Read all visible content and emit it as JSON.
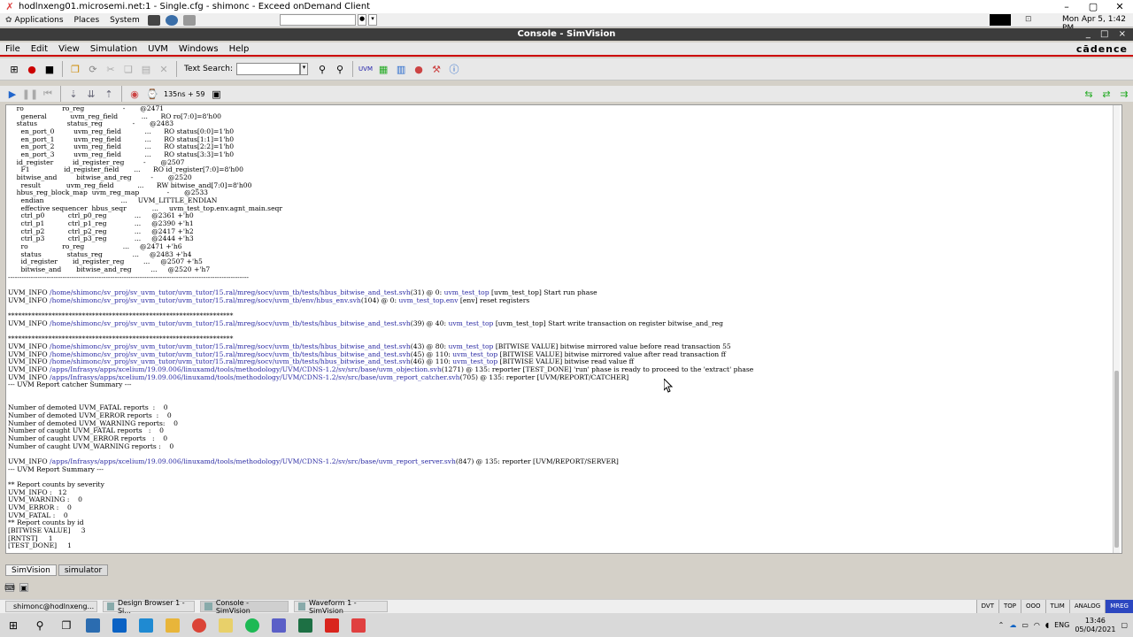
{
  "exceed": {
    "title": "hodlnxeng01.microsemi.net:1 - Single.cfg - shimonc - Exceed onDemand Client",
    "controls": [
      "–",
      "▢",
      "✕"
    ]
  },
  "gnome_panel": {
    "menus": [
      "Applications",
      "Places",
      "System"
    ],
    "clock": "Mon Apr 5,  1:42 PM"
  },
  "console_window": {
    "title": "Console - SimVision",
    "controls": "_ □ ×"
  },
  "menubar": {
    "items": [
      "File",
      "Edit",
      "View",
      "Simulation",
      "UVM",
      "Windows",
      "Help"
    ],
    "brand": "cādence"
  },
  "toolbar": {
    "text_search_label": "Text Search:",
    "sim_time": "135ns + 59"
  },
  "console_lines": [
    {
      "t": "    ro                  ro_reg                  -       @2471"
    },
    {
      "t": "      general           uvm_reg_field           ...      RO ro[7:0]=8'h00"
    },
    {
      "t": "    status              status_reg              -       @2483"
    },
    {
      "t": "      en_port_0         uvm_reg_field           ...      RO status[0:0]=1'h0"
    },
    {
      "t": "      en_port_1         uvm_reg_field           ...      RO status[1:1]=1'h0"
    },
    {
      "t": "      en_port_2         uvm_reg_field           ...      RO status[2:2]=1'h0"
    },
    {
      "t": "      en_port_3         uvm_reg_field           ...      RO status[3:3]=1'h0"
    },
    {
      "t": "    id_register         id_register_reg         -       @2507"
    },
    {
      "t": "      F1                id_register_field       ...      RO id_register[7:0]=8'h00"
    },
    {
      "t": "    bitwise_and         bitwise_and_reg         -       @2520"
    },
    {
      "t": "      result            uvm_reg_field           ...      RW bitwise_and[7:0]=8'h00"
    },
    {
      "t": "    hbus_reg_block_map  uvm_reg_map             -       @2533"
    },
    {
      "t": "      endian                                    ...     UVM_LITTLE_ENDIAN"
    },
    {
      "t": "      effective sequencer  hbus_seqr            ...     uvm_test_top.env.agnt_main.seqr"
    },
    {
      "t": "      ctrl_p0           ctrl_p0_reg             ...     @2361 +'h0"
    },
    {
      "t": "      ctrl_p1           ctrl_p1_reg             ...     @2390 +'h1"
    },
    {
      "t": "      ctrl_p2           ctrl_p2_reg             ...     @2417 +'h2"
    },
    {
      "t": "      ctrl_p3           ctrl_p3_reg             ...     @2444 +'h3"
    },
    {
      "t": "      ro                ro_reg                  ...     @2471 +'h6"
    },
    {
      "t": "      status            status_reg              ...     @2483 +'h4"
    },
    {
      "t": "      id_register       id_register_reg         ...     @2507 +'h5"
    },
    {
      "t": "      bitwise_and       bitwise_and_reg         ...     @2520 +'h7"
    },
    {
      "t": "----------------------------------------------------------------------------------------------------------"
    },
    {
      "t": ""
    },
    {
      "t": "UVM_INFO ",
      "p": "/home/shimonc/sv_proj/sv_uvm_tutor/uvm_tutor/15.ral/mreg/socv/uvm_tb/tests/hbus_bitwise_and_test.svh",
      "r": "(31) @ 0: ",
      "p2": "uvm_test_top",
      "r2": " [uvm_test_top] Start run phase"
    },
    {
      "t": "UVM_INFO ",
      "p": "/home/shimonc/sv_proj/sv_uvm_tutor/uvm_tutor/15.ral/mreg/socv/uvm_tb/env/hbus_env.svh",
      "r": "(104) @ 0: ",
      "p2": "uvm_test_top.env",
      "r2": " [env] reset registers"
    },
    {
      "t": ""
    },
    {
      "t": "*******************************************************************"
    },
    {
      "t": "UVM_INFO ",
      "p": "/home/shimonc/sv_proj/sv_uvm_tutor/uvm_tutor/15.ral/mreg/socv/uvm_tb/tests/hbus_bitwise_and_test.svh",
      "r": "(39) @ 40: ",
      "p2": "uvm_test_top",
      "r2": " [uvm_test_top] Start write transaction on register bitwise_and_reg"
    },
    {
      "t": ""
    },
    {
      "t": "*******************************************************************"
    },
    {
      "t": "UVM_INFO ",
      "p": "/home/shimonc/sv_proj/sv_uvm_tutor/uvm_tutor/15.ral/mreg/socv/uvm_tb/tests/hbus_bitwise_and_test.svh",
      "r": "(43) @ 80: ",
      "p2": "uvm_test_top",
      "r2": " [BITWISE VALUE] bitwise mirrored value before read transaction 55"
    },
    {
      "t": "UVM_INFO ",
      "p": "/home/shimonc/sv_proj/sv_uvm_tutor/uvm_tutor/15.ral/mreg/socv/uvm_tb/tests/hbus_bitwise_and_test.svh",
      "r": "(45) @ 110: ",
      "p2": "uvm_test_top",
      "r2": " [BITWISE VALUE] bitwise mirrored value after read transaction ff"
    },
    {
      "t": "UVM_INFO ",
      "p": "/home/shimonc/sv_proj/sv_uvm_tutor/uvm_tutor/15.ral/mreg/socv/uvm_tb/tests/hbus_bitwise_and_test.svh",
      "r": "(46) @ 110: ",
      "p2": "uvm_test_top",
      "r2": " [BITWISE VALUE] bitwise read value ff"
    },
    {
      "t": "UVM_INFO ",
      "p": "/apps/Infrasys/apps/xcelium/19.09.006/linuxamd/tools/methodology/UVM/CDNS-1.2/sv/src/base/uvm_objection.svh",
      "r": "(1271) @ 135: reporter [TEST_DONE] 'run' phase is ready to proceed to the 'extract' phase"
    },
    {
      "t": "UVM_INFO ",
      "p": "/apps/Infrasys/apps/xcelium/19.09.006/linuxamd/tools/methodology/UVM/CDNS-1.2/sv/src/base/uvm_report_catcher.svh",
      "r": "(705) @ 135: reporter [UVM/REPORT/CATCHER]"
    },
    {
      "t": "--- UVM Report catcher Summary ---"
    },
    {
      "t": ""
    },
    {
      "t": ""
    },
    {
      "t": "Number of demoted UVM_FATAL reports  :    0"
    },
    {
      "t": "Number of demoted UVM_ERROR reports  :    0"
    },
    {
      "t": "Number of demoted UVM_WARNING reports:    0"
    },
    {
      "t": "Number of caught UVM_FATAL reports   :    0"
    },
    {
      "t": "Number of caught UVM_ERROR reports   :    0"
    },
    {
      "t": "Number of caught UVM_WARNING reports :    0"
    },
    {
      "t": ""
    },
    {
      "t": "UVM_INFO ",
      "p": "/apps/Infrasys/apps/xcelium/19.09.006/linuxamd/tools/methodology/UVM/CDNS-1.2/sv/src/base/uvm_report_server.svh",
      "r": "(847) @ 135: reporter [UVM/REPORT/SERVER]"
    },
    {
      "t": "--- UVM Report Summary ---"
    },
    {
      "t": ""
    },
    {
      "t": "** Report counts by severity"
    },
    {
      "t": "UVM_INFO :   12"
    },
    {
      "t": "UVM_WARNING :    0"
    },
    {
      "t": "UVM_ERROR :    0"
    },
    {
      "t": "UVM_FATAL :    0"
    },
    {
      "t": "** Report counts by id"
    },
    {
      "t": "[BITWISE VALUE]     3"
    },
    {
      "t": "[RNTST]     1"
    },
    {
      "t": "[TEST_DONE]     1"
    }
  ],
  "tabs": [
    "SimVision",
    "simulator"
  ],
  "gnome_tasks": [
    "shimonc@hodlnxeng...",
    "Design Browser 1 - Si...",
    "Console - SimVision",
    "Waveform 1 - SimVision"
  ],
  "status_cells": [
    "DVT",
    "TOP",
    "OOO",
    "TLIM",
    "ANALOG",
    "MREG"
  ],
  "tray": {
    "lang": "ENG",
    "time": "13:46",
    "date": "05/04/2021"
  }
}
